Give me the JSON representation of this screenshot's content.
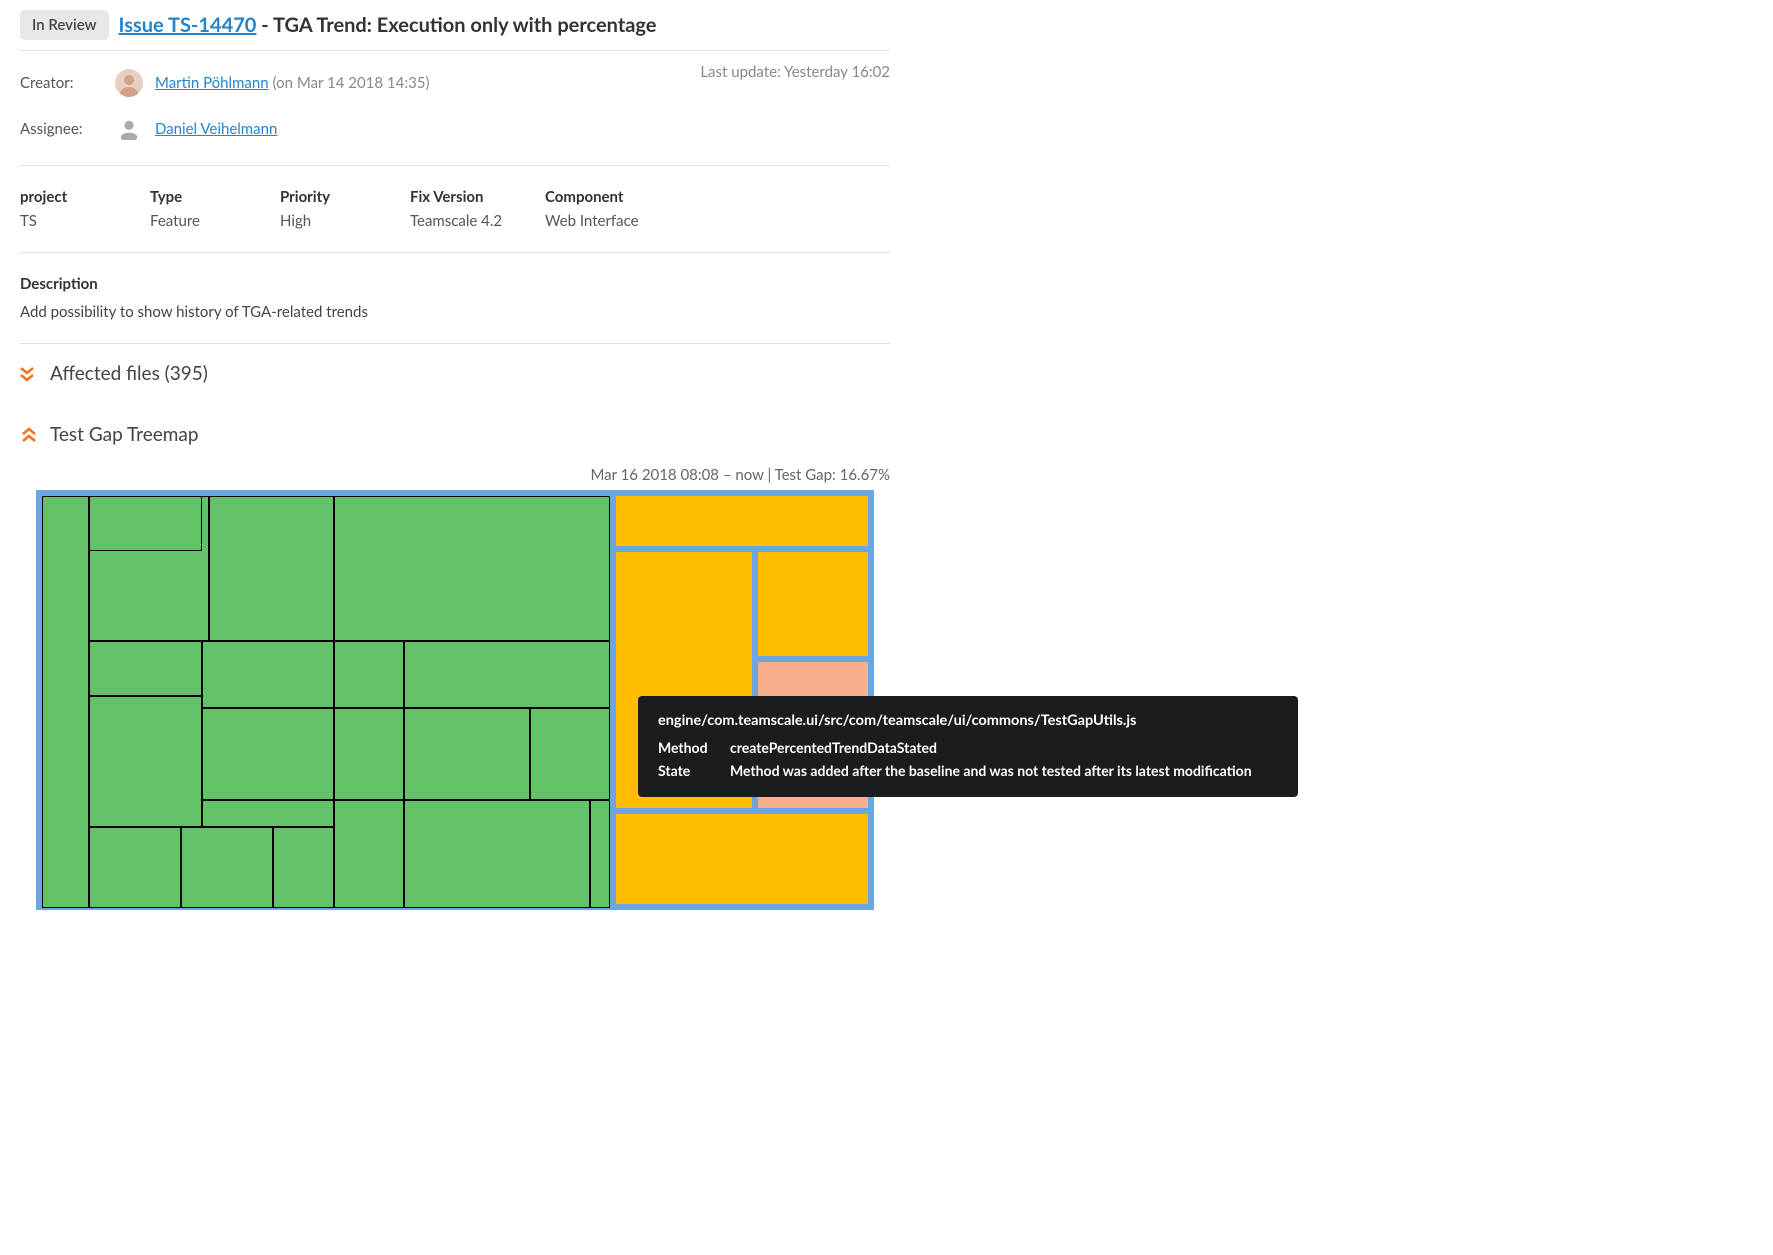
{
  "header": {
    "status": "In Review",
    "issue_id": "Issue TS-14470",
    "title_sep": " - ",
    "title": "TGA Trend: Execution only with percentage"
  },
  "meta": {
    "last_update_label": "Last update: Yesterday 16:02",
    "creator_label": "Creator:",
    "creator_name": "Martin Pöhlmann",
    "creator_date": "(on Mar 14 2018 14:35)",
    "assignee_label": "Assignee:",
    "assignee_name": "Daniel Veihelmann"
  },
  "fields": {
    "project": {
      "label": "project",
      "value": "TS"
    },
    "type": {
      "label": "Type",
      "value": "Feature"
    },
    "priority": {
      "label": "Priority",
      "value": "High"
    },
    "fix_version": {
      "label": "Fix Version",
      "value": "Teamscale 4.2"
    },
    "component": {
      "label": "Component",
      "value": "Web Interface"
    }
  },
  "description": {
    "label": "Description",
    "text": "Add possibility to show history of TGA-related trends"
  },
  "sections": {
    "affected_files": "Affected files (395)",
    "test_gap": "Test Gap Treemap"
  },
  "treemap": {
    "caption": "Mar 16 2018 08:08 – now | Test Gap: 16.67%"
  },
  "tooltip": {
    "path": "engine/com.teamscale.ui/src/com/teamscale/ui/commons/TestGapUtils.js",
    "method_label": "Method",
    "method_value": "createPercentedTrendDataStated",
    "state_label": "State",
    "state_value": "Method was added after the baseline and was not tested after its latest modification"
  }
}
